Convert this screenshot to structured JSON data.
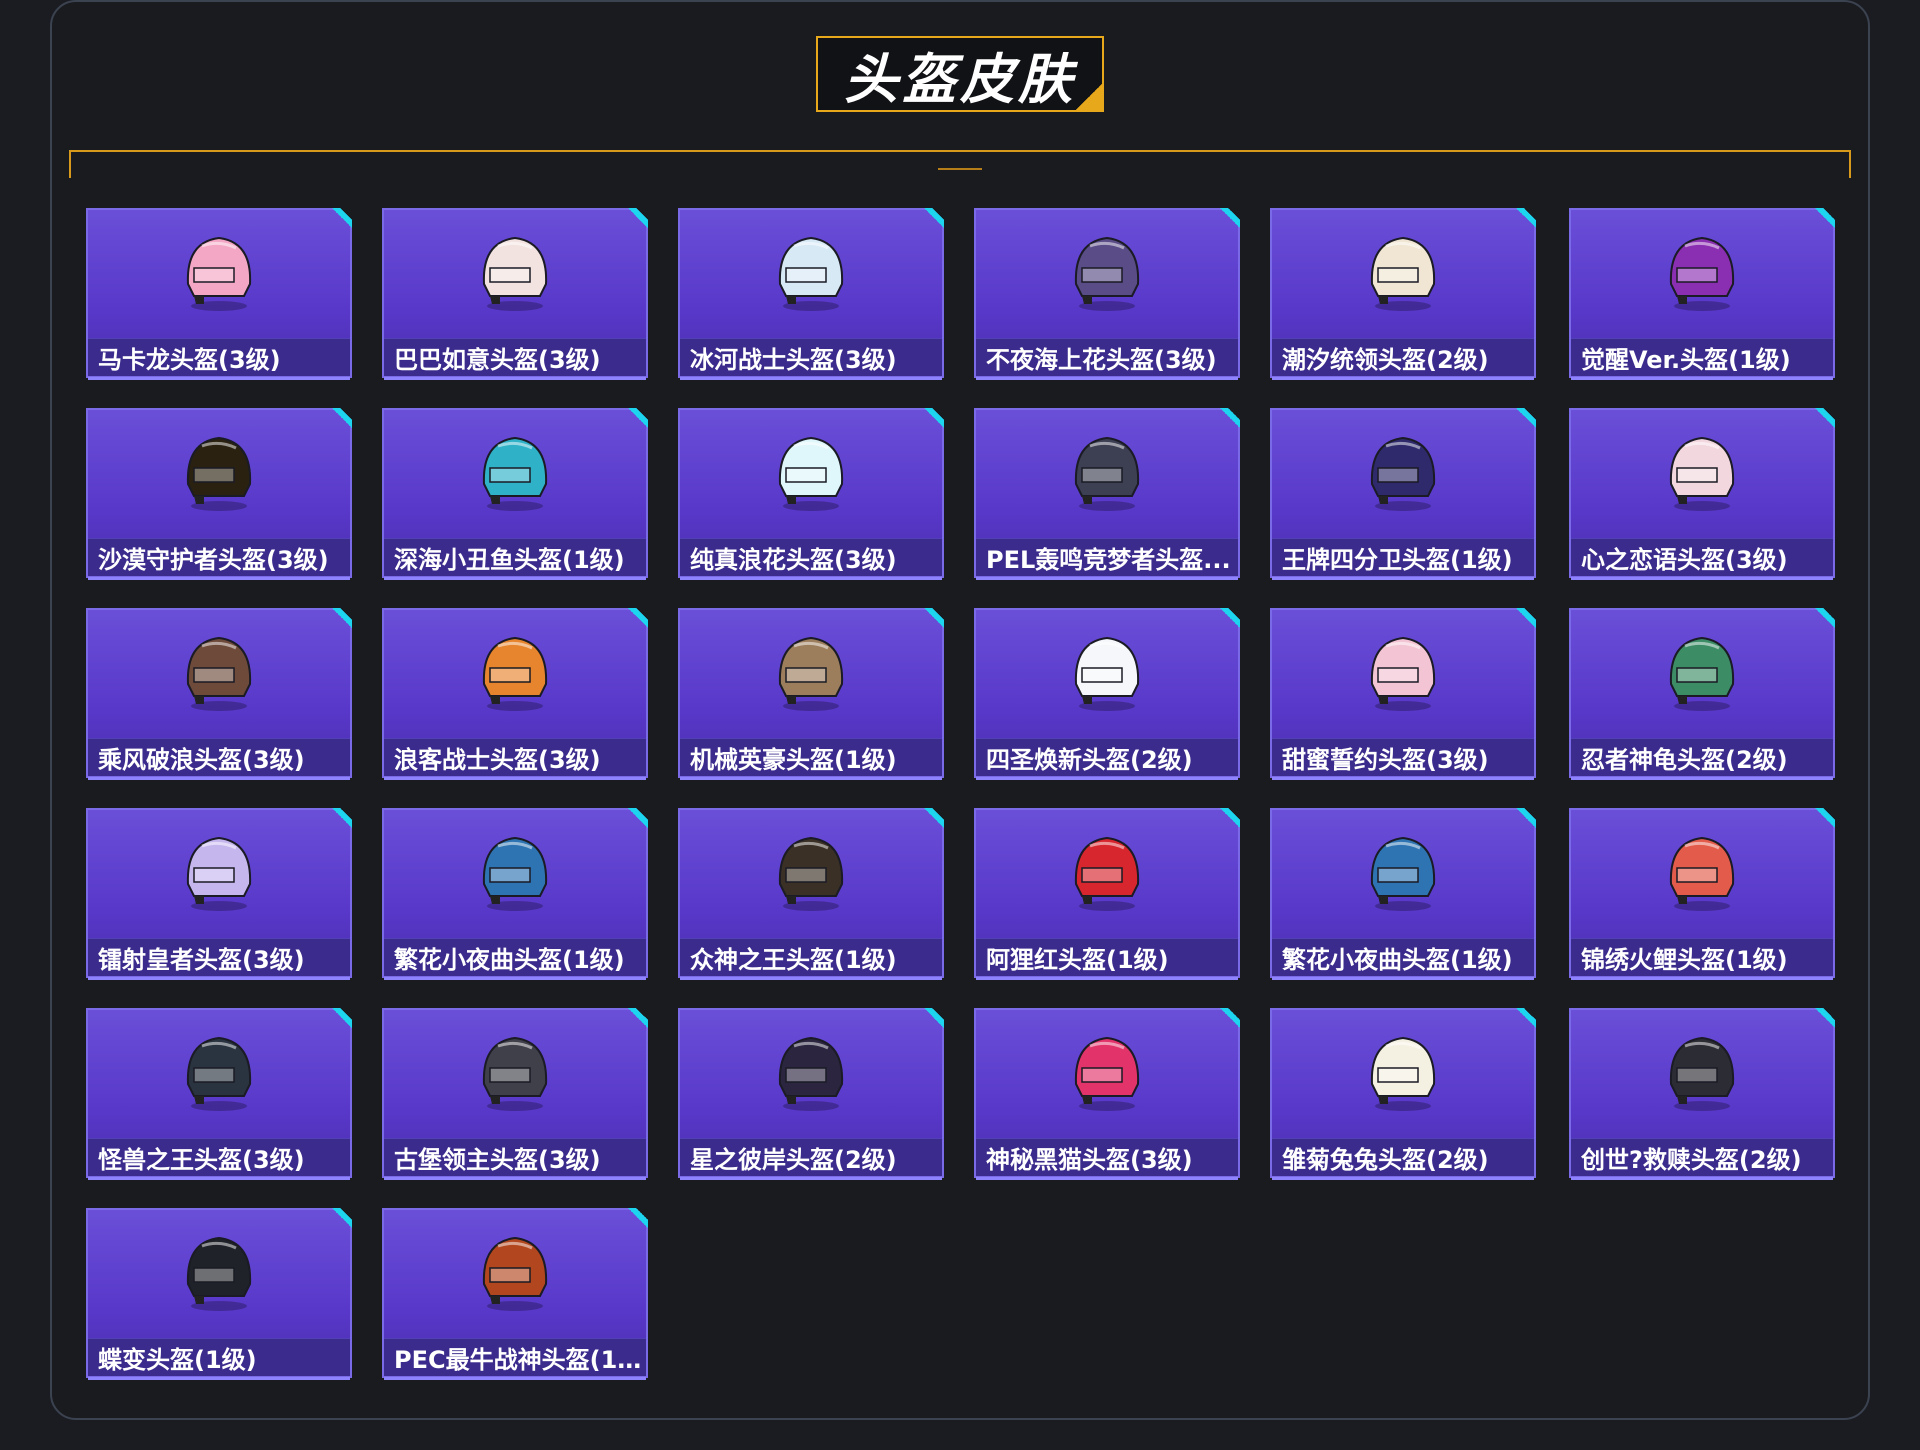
{
  "page": {
    "title": "头盔皮肤"
  },
  "colors": {
    "accent": "#e8a81c",
    "card": "#5838c9",
    "corner": "#1ed5f0"
  },
  "helmets": [
    {
      "label": "马卡龙头盔(3级)",
      "color": "#f4a7c4"
    },
    {
      "label": "巴巴如意头盔(3级)",
      "color": "#f2e3e0"
    },
    {
      "label": "冰河战士头盔(3级)",
      "color": "#d7e9f5"
    },
    {
      "label": "不夜海上花头盔(3级)",
      "color": "#5a4c86"
    },
    {
      "label": "潮汐统领头盔(2级)",
      "color": "#f0e6d3"
    },
    {
      "label": "觉醒Ver.头盔(1级)",
      "color": "#8a2fb2"
    },
    {
      "label": "沙漠守护者头盔(3级)",
      "color": "#2a2110"
    },
    {
      "label": "深海小丑鱼头盔(1级)",
      "color": "#2fb1c8"
    },
    {
      "label": "纯真浪花头盔(3级)",
      "color": "#dff6fb"
    },
    {
      "label": "PEL轰鸣竞梦者头盔...",
      "color": "#3d3f52"
    },
    {
      "label": "王牌四分卫头盔(1级)",
      "color": "#2f2a6b"
    },
    {
      "label": "心之恋语头盔(3级)",
      "color": "#f2d7de"
    },
    {
      "label": "乘风破浪头盔(3级)",
      "color": "#6e4a3b"
    },
    {
      "label": "浪客战士头盔(3级)",
      "color": "#e6852e"
    },
    {
      "label": "机械英豪头盔(1级)",
      "color": "#9d7e5c"
    },
    {
      "label": "四圣焕新头盔(2级)",
      "color": "#f5f7fb"
    },
    {
      "label": "甜蜜誓约头盔(3级)",
      "color": "#f3c4d3"
    },
    {
      "label": "忍者神龟头盔(2级)",
      "color": "#3c8c66"
    },
    {
      "label": "镭射皇者头盔(3级)",
      "color": "#c6b6ee"
    },
    {
      "label": "繁花小夜曲头盔(1级)",
      "color": "#2e74b2"
    },
    {
      "label": "众神之王头盔(1级)",
      "color": "#3b3025"
    },
    {
      "label": "阿狸红头盔(1级)",
      "color": "#d8262f"
    },
    {
      "label": "繁花小夜曲头盔(1级)",
      "color": "#2e74b2"
    },
    {
      "label": "锦绣火鲤头盔(1级)",
      "color": "#e35b4a"
    },
    {
      "label": "怪兽之王头盔(3级)",
      "color": "#2a3440"
    },
    {
      "label": "古堡领主头盔(3级)",
      "color": "#40404a"
    },
    {
      "label": "星之彼岸头盔(2级)",
      "color": "#2b2540"
    },
    {
      "label": "神秘黑猫头盔(3级)",
      "color": "#e2346a"
    },
    {
      "label": "雏菊兔兔头盔(2级)",
      "color": "#f4f1e2"
    },
    {
      "label": "创世?救赎头盔(2级)",
      "color": "#2c2c34"
    },
    {
      "label": "蝶变头盔(1级)",
      "color": "#1f2228"
    },
    {
      "label": "PEC最牛战神头盔(1...",
      "color": "#b2471f"
    }
  ]
}
